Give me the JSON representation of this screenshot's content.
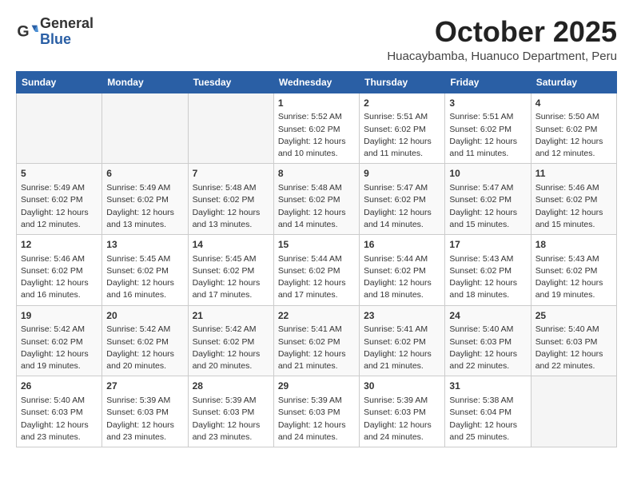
{
  "logo": {
    "general": "General",
    "blue": "Blue"
  },
  "header": {
    "month": "October 2025",
    "location": "Huacaybamba, Huanuco Department, Peru"
  },
  "weekdays": [
    "Sunday",
    "Monday",
    "Tuesday",
    "Wednesday",
    "Thursday",
    "Friday",
    "Saturday"
  ],
  "weeks": [
    [
      {
        "day": "",
        "info": ""
      },
      {
        "day": "",
        "info": ""
      },
      {
        "day": "",
        "info": ""
      },
      {
        "day": "1",
        "info": "Sunrise: 5:52 AM\nSunset: 6:02 PM\nDaylight: 12 hours and 10 minutes."
      },
      {
        "day": "2",
        "info": "Sunrise: 5:51 AM\nSunset: 6:02 PM\nDaylight: 12 hours and 11 minutes."
      },
      {
        "day": "3",
        "info": "Sunrise: 5:51 AM\nSunset: 6:02 PM\nDaylight: 12 hours and 11 minutes."
      },
      {
        "day": "4",
        "info": "Sunrise: 5:50 AM\nSunset: 6:02 PM\nDaylight: 12 hours and 12 minutes."
      }
    ],
    [
      {
        "day": "5",
        "info": "Sunrise: 5:49 AM\nSunset: 6:02 PM\nDaylight: 12 hours and 12 minutes."
      },
      {
        "day": "6",
        "info": "Sunrise: 5:49 AM\nSunset: 6:02 PM\nDaylight: 12 hours and 13 minutes."
      },
      {
        "day": "7",
        "info": "Sunrise: 5:48 AM\nSunset: 6:02 PM\nDaylight: 12 hours and 13 minutes."
      },
      {
        "day": "8",
        "info": "Sunrise: 5:48 AM\nSunset: 6:02 PM\nDaylight: 12 hours and 14 minutes."
      },
      {
        "day": "9",
        "info": "Sunrise: 5:47 AM\nSunset: 6:02 PM\nDaylight: 12 hours and 14 minutes."
      },
      {
        "day": "10",
        "info": "Sunrise: 5:47 AM\nSunset: 6:02 PM\nDaylight: 12 hours and 15 minutes."
      },
      {
        "day": "11",
        "info": "Sunrise: 5:46 AM\nSunset: 6:02 PM\nDaylight: 12 hours and 15 minutes."
      }
    ],
    [
      {
        "day": "12",
        "info": "Sunrise: 5:46 AM\nSunset: 6:02 PM\nDaylight: 12 hours and 16 minutes."
      },
      {
        "day": "13",
        "info": "Sunrise: 5:45 AM\nSunset: 6:02 PM\nDaylight: 12 hours and 16 minutes."
      },
      {
        "day": "14",
        "info": "Sunrise: 5:45 AM\nSunset: 6:02 PM\nDaylight: 12 hours and 17 minutes."
      },
      {
        "day": "15",
        "info": "Sunrise: 5:44 AM\nSunset: 6:02 PM\nDaylight: 12 hours and 17 minutes."
      },
      {
        "day": "16",
        "info": "Sunrise: 5:44 AM\nSunset: 6:02 PM\nDaylight: 12 hours and 18 minutes."
      },
      {
        "day": "17",
        "info": "Sunrise: 5:43 AM\nSunset: 6:02 PM\nDaylight: 12 hours and 18 minutes."
      },
      {
        "day": "18",
        "info": "Sunrise: 5:43 AM\nSunset: 6:02 PM\nDaylight: 12 hours and 19 minutes."
      }
    ],
    [
      {
        "day": "19",
        "info": "Sunrise: 5:42 AM\nSunset: 6:02 PM\nDaylight: 12 hours and 19 minutes."
      },
      {
        "day": "20",
        "info": "Sunrise: 5:42 AM\nSunset: 6:02 PM\nDaylight: 12 hours and 20 minutes."
      },
      {
        "day": "21",
        "info": "Sunrise: 5:42 AM\nSunset: 6:02 PM\nDaylight: 12 hours and 20 minutes."
      },
      {
        "day": "22",
        "info": "Sunrise: 5:41 AM\nSunset: 6:02 PM\nDaylight: 12 hours and 21 minutes."
      },
      {
        "day": "23",
        "info": "Sunrise: 5:41 AM\nSunset: 6:02 PM\nDaylight: 12 hours and 21 minutes."
      },
      {
        "day": "24",
        "info": "Sunrise: 5:40 AM\nSunset: 6:03 PM\nDaylight: 12 hours and 22 minutes."
      },
      {
        "day": "25",
        "info": "Sunrise: 5:40 AM\nSunset: 6:03 PM\nDaylight: 12 hours and 22 minutes."
      }
    ],
    [
      {
        "day": "26",
        "info": "Sunrise: 5:40 AM\nSunset: 6:03 PM\nDaylight: 12 hours and 23 minutes."
      },
      {
        "day": "27",
        "info": "Sunrise: 5:39 AM\nSunset: 6:03 PM\nDaylight: 12 hours and 23 minutes."
      },
      {
        "day": "28",
        "info": "Sunrise: 5:39 AM\nSunset: 6:03 PM\nDaylight: 12 hours and 23 minutes."
      },
      {
        "day": "29",
        "info": "Sunrise: 5:39 AM\nSunset: 6:03 PM\nDaylight: 12 hours and 24 minutes."
      },
      {
        "day": "30",
        "info": "Sunrise: 5:39 AM\nSunset: 6:03 PM\nDaylight: 12 hours and 24 minutes."
      },
      {
        "day": "31",
        "info": "Sunrise: 5:38 AM\nSunset: 6:04 PM\nDaylight: 12 hours and 25 minutes."
      },
      {
        "day": "",
        "info": ""
      }
    ]
  ]
}
